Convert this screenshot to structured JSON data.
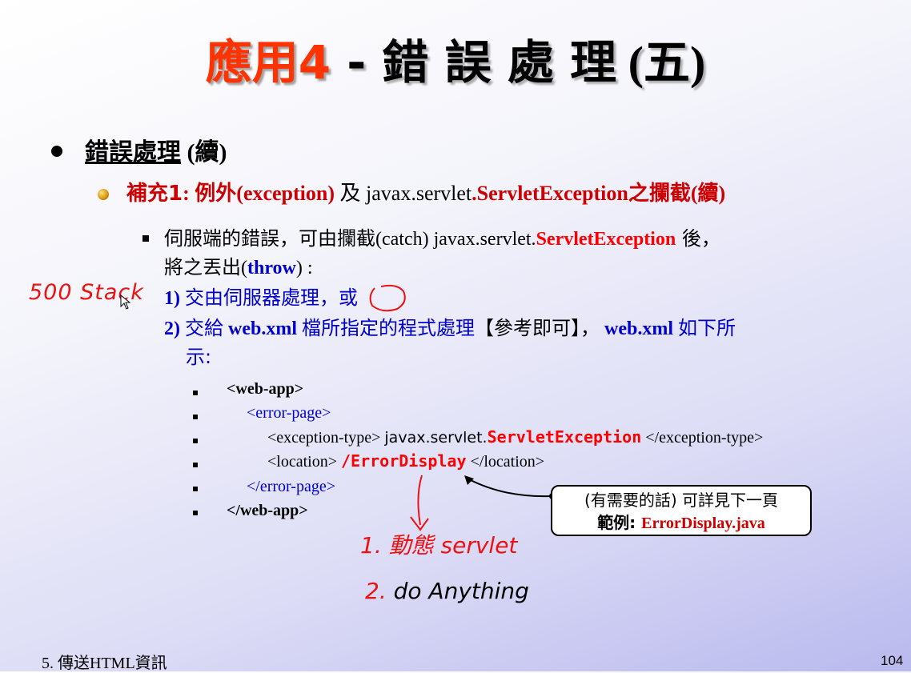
{
  "slide": {
    "title_part1": "應用4",
    "title_dash": " - ",
    "title_part2": "錯 誤 處 理",
    "title_part3": " (五)",
    "level1": {
      "cjk": "錯誤處理",
      "rest": " (續)"
    },
    "level2": {
      "p1": "補充1",
      "p2": ": ",
      "p3": "例外",
      "p4": "(exception) ",
      "p5": "及",
      "p6": " javax.servlet",
      "p7": ".ServletException",
      "p8": "之攔截",
      "p9": "(續)"
    },
    "level3": {
      "line1_a": "伺服端的錯誤，可由攔截",
      "line1_b": "(catch)  javax.servlet.",
      "line1_c": "ServletException",
      "line1_d": " 後，",
      "line2_a": "將之丟出",
      "line2_b": "(",
      "line2_c": "throw",
      "line2_d": ") :",
      "opt1_a": "1) ",
      "opt1_b": "交由伺服器處理，或",
      "opt2_a": "2) ",
      "opt2_b": "交給",
      "opt2_c": " web.xml ",
      "opt2_d": "檔所指定的程式處理",
      "opt2_e": "【參考即可】，",
      "opt2_f": " web.xml ",
      "opt2_g": " 如下所",
      "opt2_h": "示:"
    },
    "code": {
      "l1": "<web-app>",
      "l2": "<error-page>",
      "l3_a": "<exception-type> ",
      "l3_b": "javax.servlet.",
      "l3_c": "ServletException",
      "l3_d": " </exception-type>",
      "l4_a": "<location> ",
      "l4_b": "/ErrorDisplay",
      "l4_c": " </location>",
      "l5": "</error-page>",
      "l6": "</web-app>"
    },
    "callout": {
      "line1": "(有需要的話) 可詳見下一頁",
      "line2_a": "範例:  ",
      "line2_b": "ErrorDisplay.java"
    },
    "footer_left": "5. 傳送HTML資訊",
    "page_number": "104"
  },
  "annotations": {
    "left_note": "500 Stack",
    "note1": "1. 動態 servlet",
    "note2": "2. do Anything"
  },
  "colors": {
    "title_red": "#ff3300",
    "blue": "#0000cc",
    "red": "#ff0000",
    "ink_red": "#ee1111"
  }
}
